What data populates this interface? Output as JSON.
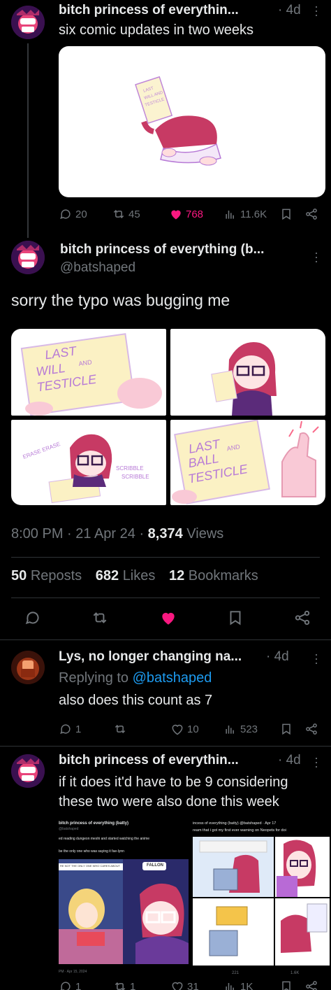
{
  "post1": {
    "name": "bitch princess of everythin...",
    "time": "· 4d",
    "text": "six comic updates in two weeks",
    "replies": "20",
    "reposts": "45",
    "likes": "768",
    "views": "11.6K"
  },
  "main": {
    "name": "bitch princess of everything (b...",
    "handle": "@batshaped",
    "text": "sorry the typo was bugging me",
    "panel1": {
      "line1": "LAST",
      "line2": "WILL",
      "and": "AND",
      "line3": "TESTICLE"
    },
    "panel3": {
      "erase": "ERASE ERASE",
      "scribble1": "SCRIBBLE",
      "scribble2": "SCRIBBLE"
    },
    "panel4": {
      "line1": "LAST",
      "line2": "BALL",
      "and": "AND",
      "line3": "TESTICLE"
    },
    "meta_time": "8:00 PM · 21 Apr 24 · ",
    "views_count": "8,374",
    "views_label": " Views",
    "reposts_count": "50",
    "reposts_label": "Reposts",
    "likes_count": "682",
    "likes_label": "Likes",
    "bookmarks_count": "12",
    "bookmarks_label": "Bookmarks"
  },
  "reply1": {
    "name": "Lys, no longer changing na...",
    "time": "· 4d",
    "replying_prefix": "Replying to ",
    "replying_handle": "@batshaped",
    "text": "also does this count as 7",
    "replies": "1",
    "reposts": "",
    "likes": "10",
    "views": "523"
  },
  "reply2": {
    "name": "bitch princess of everythin...",
    "time": "· 4d",
    "text": "if it does it'd have to be 9 considering these two were also done this week",
    "shot1": {
      "name": "bitch princess of everything (batty)",
      "handle": "@batshaped",
      "line1": "ed reading dungeon meshi and started watching the anime",
      "line2": "be the only one who was saying it fae-lynn",
      "left_label": "RE NOT THE ONLY ONE WHO CARES ABOUT",
      "right_label": "FALLON",
      "date": "PM · Apr 15, 2024"
    },
    "shot2": {
      "header": "incess of everything (batty) @batshaped · Apr 17",
      "line1": "ream that i got my first ever warning on Neopets for doi",
      "retweets": "221",
      "likes": "1.6K"
    },
    "replies": "1",
    "reposts": "1",
    "likes": "31",
    "views": "1K"
  },
  "colors": {
    "like_pink": "#f91880",
    "link_blue": "#1d9bf0",
    "muted": "#71767b"
  }
}
